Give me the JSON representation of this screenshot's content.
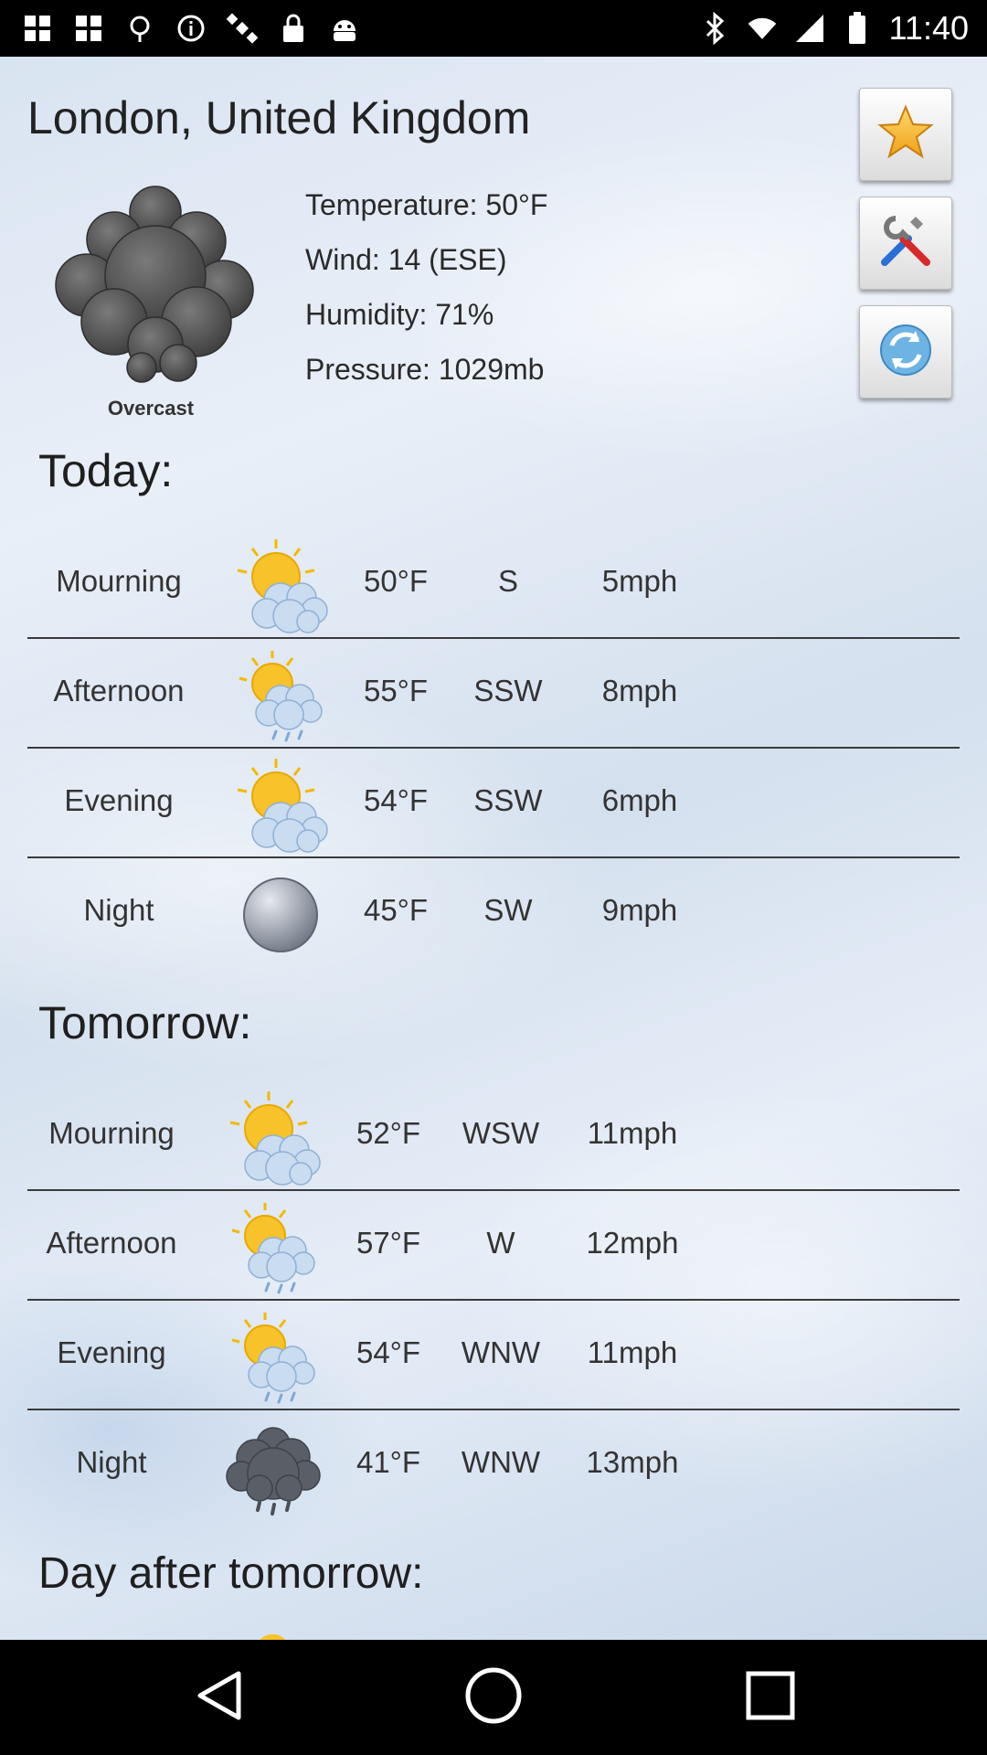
{
  "status_bar": {
    "time": "11:40",
    "left_icons": [
      "grid-icon",
      "grid-icon",
      "fake-gps-icon",
      "info-icon",
      "satellite-icon",
      "lock-icon",
      "android-icon"
    ],
    "right_icons": [
      "bluetooth-icon",
      "wifi-icon",
      "signal-icon",
      "battery-icon"
    ]
  },
  "location": "London, United Kingdom",
  "current": {
    "condition": "Overcast",
    "icon": "overcast-cloud-icon",
    "temperature": "Temperature: 50°F",
    "wind": "Wind: 14 (ESE)",
    "humidity": "Humidity: 71%",
    "pressure": "Pressure: 1029mb"
  },
  "buttons": {
    "favorite": "star-icon",
    "settings": "tools-icon",
    "refresh": "refresh-icon"
  },
  "today": {
    "title": "Today:",
    "rows": [
      {
        "period": "Mourning",
        "icon": "sun-cloud-icon",
        "temp": "50°F",
        "dir": "S",
        "speed": "5mph"
      },
      {
        "period": "Afternoon",
        "icon": "sun-cloud-rain-icon",
        "temp": "55°F",
        "dir": "SSW",
        "speed": "8mph"
      },
      {
        "period": "Evening",
        "icon": "sun-cloud-icon",
        "temp": "54°F",
        "dir": "SSW",
        "speed": "6mph"
      },
      {
        "period": "Night",
        "icon": "moon-icon",
        "temp": "45°F",
        "dir": "SW",
        "speed": "9mph"
      }
    ]
  },
  "tomorrow": {
    "title": "Tomorrow:",
    "rows": [
      {
        "period": "Mourning",
        "icon": "sun-cloud-icon",
        "temp": "52°F",
        "dir": "WSW",
        "speed": "11mph"
      },
      {
        "period": "Afternoon",
        "icon": "sun-cloud-rain-icon",
        "temp": "57°F",
        "dir": "W",
        "speed": "12mph"
      },
      {
        "period": "Evening",
        "icon": "sun-cloud-rain-icon",
        "temp": "54°F",
        "dir": "WNW",
        "speed": "11mph"
      },
      {
        "period": "Night",
        "icon": "dark-cloud-rain-icon",
        "temp": "41°F",
        "dir": "WNW",
        "speed": "13mph"
      }
    ]
  },
  "day_after": {
    "title": "Day after tomorrow:"
  },
  "nav": {
    "back": "back-icon",
    "home": "home-icon",
    "recents": "recents-icon"
  },
  "colors": {
    "background": "#dfe8f3",
    "text": "#333333",
    "divider": "#3a3a3a"
  }
}
